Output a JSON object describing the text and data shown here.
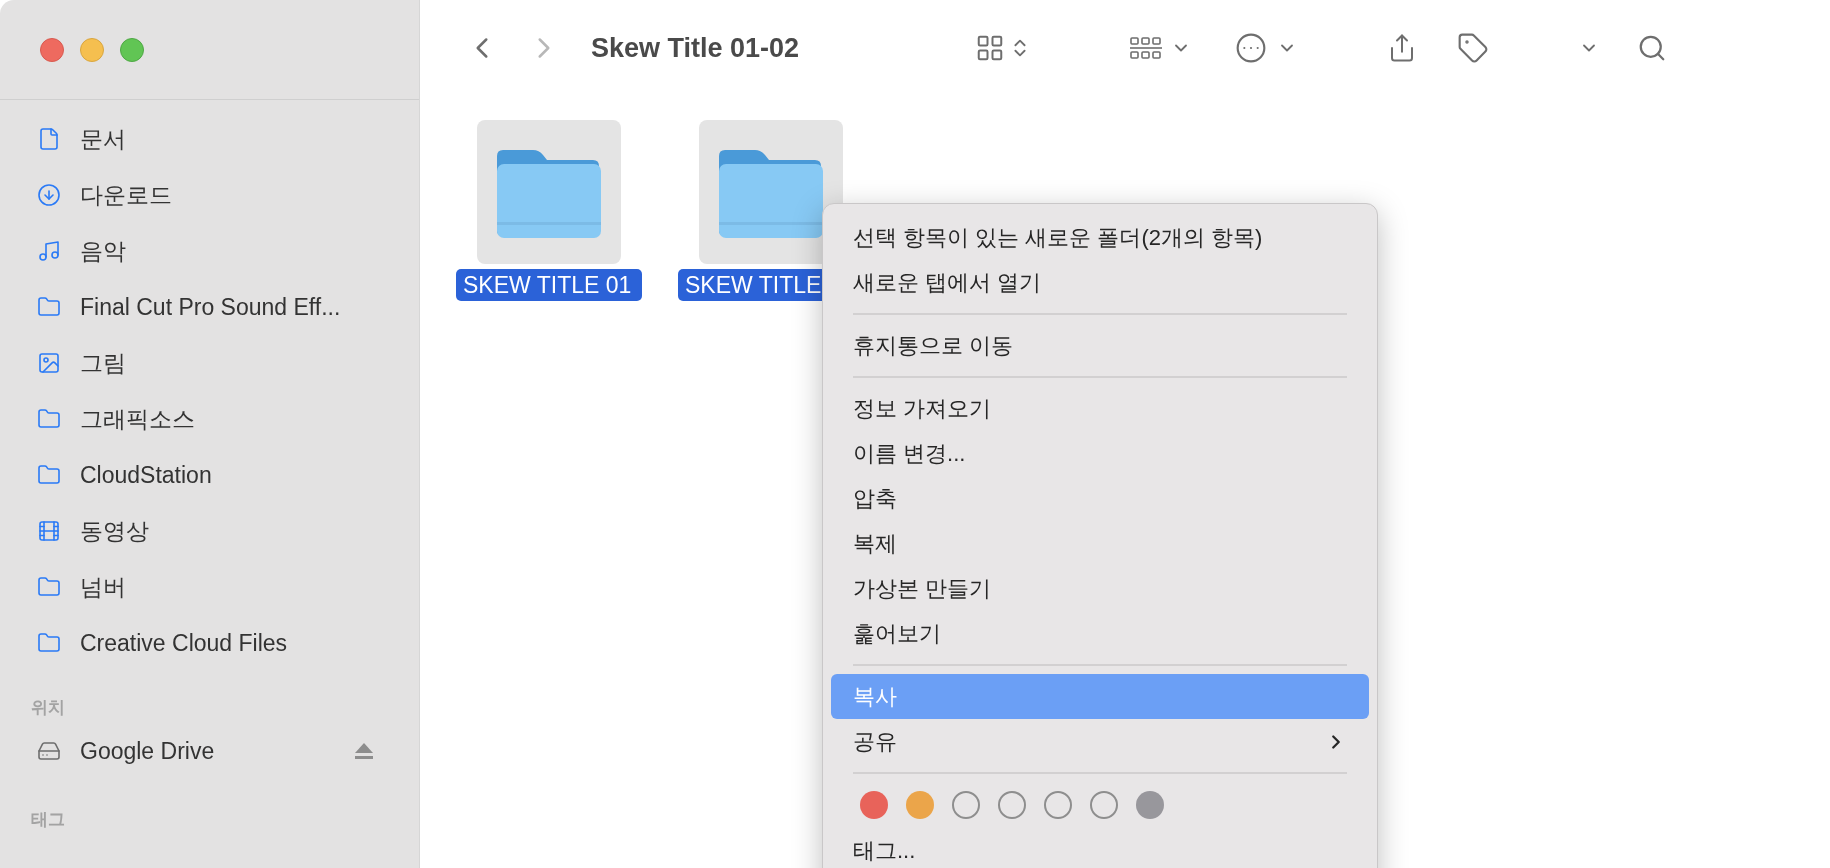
{
  "window": {
    "title": "Skew Title 01-02"
  },
  "sidebar": {
    "favorites": [
      {
        "label": "문서",
        "kind": "document"
      },
      {
        "label": "다운로드",
        "kind": "download"
      },
      {
        "label": "음악",
        "kind": "music"
      },
      {
        "label": "Final Cut Pro Sound Eff...",
        "kind": "folder"
      },
      {
        "label": "그림",
        "kind": "picture"
      },
      {
        "label": "그래픽소스",
        "kind": "folder"
      },
      {
        "label": "CloudStation",
        "kind": "folder"
      },
      {
        "label": "동영상",
        "kind": "film"
      },
      {
        "label": "넘버",
        "kind": "folder"
      },
      {
        "label": "Creative Cloud Files",
        "kind": "folder"
      }
    ],
    "locations": {
      "heading": "위치",
      "items": [
        {
          "label": "Google Drive",
          "kind": "drive",
          "ejectable": true
        }
      ]
    },
    "tags": {
      "heading": "태그"
    }
  },
  "folders": [
    {
      "name": "SKEW TITLE 01",
      "selected": true
    },
    {
      "name": "SKEW TITLE",
      "selected": true
    }
  ],
  "context_menu": {
    "groups": [
      [
        {
          "label": "선택 항목이 있는 새로운 폴더(2개의 항목)",
          "highlighted": false,
          "submenu": false
        },
        {
          "label": "새로운 탭에서 열기",
          "highlighted": false,
          "submenu": false
        }
      ],
      [
        {
          "label": "휴지통으로 이동",
          "highlighted": false,
          "submenu": false
        }
      ],
      [
        {
          "label": "정보 가져오기",
          "highlighted": false,
          "submenu": false
        },
        {
          "label": "이름 변경...",
          "highlighted": false,
          "submenu": false
        },
        {
          "label": "압축",
          "highlighted": false,
          "submenu": false
        },
        {
          "label": "복제",
          "highlighted": false,
          "submenu": false
        },
        {
          "label": "가상본 만들기",
          "highlighted": false,
          "submenu": false
        },
        {
          "label": "훑어보기",
          "highlighted": false,
          "submenu": false
        }
      ],
      [
        {
          "label": "복사",
          "highlighted": true,
          "submenu": false
        },
        {
          "label": "공유",
          "highlighted": false,
          "submenu": true
        }
      ]
    ],
    "tag_colors": [
      {
        "kind": "filled",
        "color": "#e8635a"
      },
      {
        "kind": "filled",
        "color": "#eba54a"
      },
      {
        "kind": "outline"
      },
      {
        "kind": "outline"
      },
      {
        "kind": "outline"
      },
      {
        "kind": "outline"
      },
      {
        "kind": "filled",
        "color": "#98979c"
      }
    ],
    "last_item": {
      "label": "태그...",
      "highlighted": false,
      "submenu": false
    }
  }
}
